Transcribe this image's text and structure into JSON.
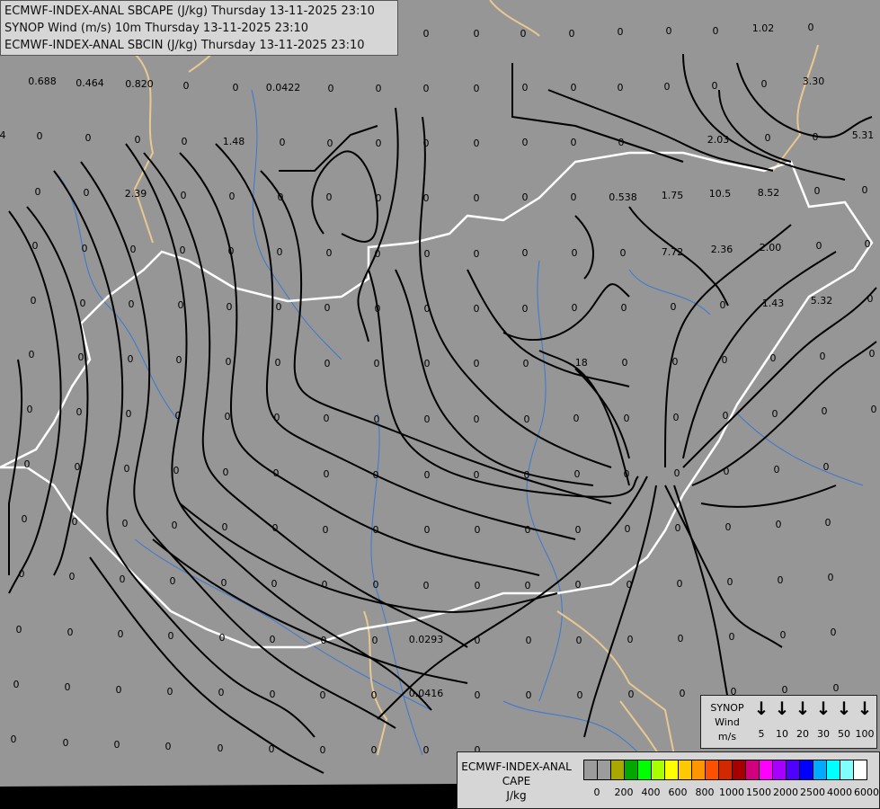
{
  "header": {
    "lines": [
      "ECMWF-INDEX-ANAL SBCAPE (J/kg) Thursday 13-11-2025 23:10",
      "SYNOP Wind (m/s) 10m Thursday 13-11-2025 23:10",
      "ECMWF-INDEX-ANAL SBCIN (J/kg) Thursday 13-11-2025 23:10"
    ]
  },
  "colors": {
    "background": "#969696",
    "streamline": "#000000",
    "country_border": "#ffffff",
    "region_border": "#e8c890",
    "river": "#3a78d0"
  },
  "wind_legend": {
    "title": [
      "SYNOP",
      "Wind",
      "m/s"
    ],
    "arrow_icon": "down-arrow-icon",
    "values": [
      "5",
      "10",
      "20",
      "30",
      "50",
      "100"
    ]
  },
  "cape_legend": {
    "title": [
      "ECMWF-INDEX-ANAL",
      "CAPE",
      "J/kg"
    ],
    "colors": [
      "#9c9c9c",
      "#9c9c9c",
      "#a8a800",
      "#00a800",
      "#00ff00",
      "#a8ff00",
      "#ffff00",
      "#ffc800",
      "#ff9600",
      "#ff5000",
      "#d22800",
      "#a80000",
      "#d2007d",
      "#ff00ff",
      "#a800ff",
      "#5000ff",
      "#0000ff",
      "#00aaff",
      "#00ffff",
      "#80ffff",
      "#ffffff"
    ],
    "ticks": [
      "0",
      "200",
      "400",
      "600",
      "800",
      "1000",
      "1500",
      "2000",
      "2500",
      "4000",
      "6000"
    ]
  },
  "cape_labels": [
    "0.688",
    "0.464",
    "0.820",
    "0",
    "0",
    "0.0422",
    "0",
    "0",
    "0",
    "0",
    "0",
    "0",
    "0",
    "0",
    "0",
    "0",
    "3.30",
    "0",
    "0",
    "0",
    "0",
    "0",
    "0",
    "0",
    "1.02",
    "0",
    "4",
    "0",
    "0",
    "0",
    "0",
    "1.48",
    "0",
    "0",
    "0",
    "0",
    "0",
    "0",
    "0",
    "0",
    "2.03",
    "0",
    "0",
    "5.31",
    "0",
    "0",
    "2.39",
    "0",
    "0",
    "0",
    "0",
    "0",
    "0",
    "0",
    "0",
    "0",
    "0.538",
    "1.75",
    "10.5",
    "8.52",
    "0",
    "0",
    "0",
    "0",
    "0",
    "0",
    "0",
    "0",
    "0",
    "0",
    "0",
    "0",
    "0",
    "0",
    "0",
    "7.72",
    "2.36",
    "2.00",
    "0",
    "0",
    "0",
    "0",
    "0",
    "0",
    "0",
    "0",
    "0",
    "0",
    "0",
    "0",
    "0",
    "0",
    "0",
    "0",
    "0",
    "1.43",
    "5.32",
    "0",
    "0",
    "0",
    "0",
    "0",
    "0",
    "0",
    "0",
    "0",
    "0",
    "0",
    "0",
    ".18",
    "0",
    "0",
    "0",
    "0",
    "0",
    "0",
    "0",
    "0",
    "0",
    "0",
    "0",
    "0",
    "0",
    "0",
    "0",
    "0",
    "0",
    "0",
    "0",
    "0",
    "0",
    "0",
    "0",
    "0",
    "0",
    "0",
    "0",
    "0",
    "0",
    "0",
    "0",
    "0",
    "0",
    "0",
    "0",
    "0",
    "0",
    "0",
    "0",
    "0",
    "0",
    "0",
    "0",
    "0",
    "0",
    "0",
    "0",
    "0",
    "0",
    "0",
    "0",
    "0",
    "0",
    "0",
    "0",
    "0",
    "0",
    "0",
    "0",
    "0",
    "0",
    "0",
    "0",
    "0",
    "0",
    "0",
    "0",
    "0",
    "0",
    "0",
    "0",
    "0",
    "0",
    "0",
    "0",
    "0",
    "0",
    "0",
    "0",
    "0",
    "0",
    "0",
    "0",
    "0.0293",
    "0",
    "0",
    "0",
    "0",
    "0",
    "0",
    "0",
    "0",
    "0",
    "0",
    "0",
    "0",
    "0",
    "0",
    "0",
    "0",
    "0.0416",
    "0",
    "0",
    "0",
    "0",
    "0",
    "0",
    "0",
    "0",
    "0",
    "0",
    "0",
    "0",
    "0",
    "0",
    "0",
    "0",
    "0",
    "0"
  ]
}
